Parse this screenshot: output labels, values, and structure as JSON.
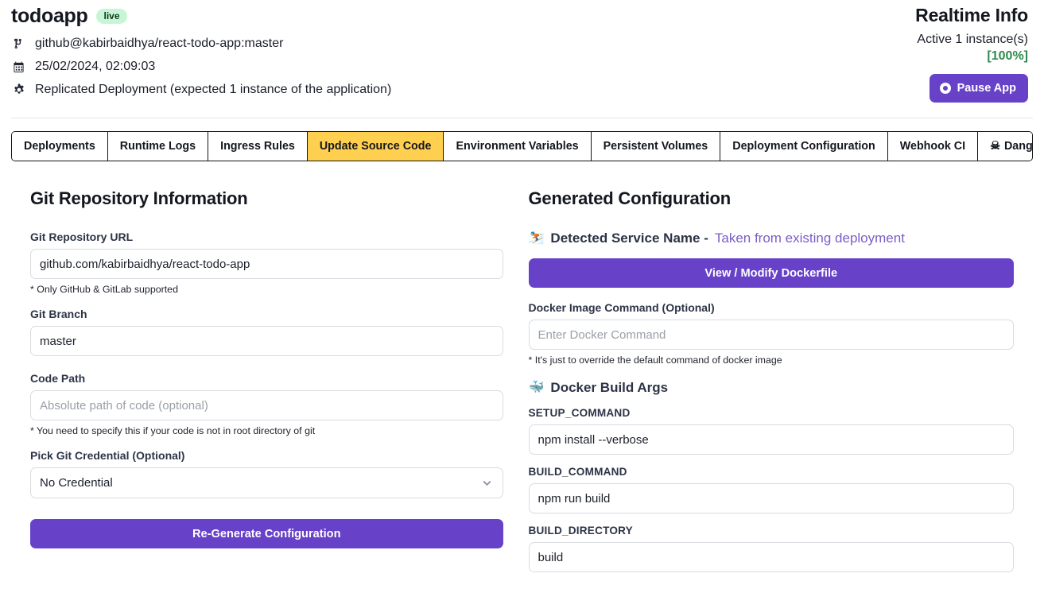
{
  "header": {
    "app_title": "todoapp",
    "status_badge": "live",
    "repo": "github@kabirbaidhya/react-todo-app:master",
    "timestamp": "25/02/2024, 02:09:03",
    "deployment_info": "Replicated Deployment (expected 1 instance of the application)",
    "icons": {
      "repo": "git-branch-icon",
      "date": "calendar-icon",
      "deployment": "gear-icon"
    }
  },
  "realtime": {
    "title": "Realtime Info",
    "active_text": "Active 1 instance(s)",
    "percent": "[100%]",
    "percent_color": "#2f8a4e",
    "pause_label": "Pause App",
    "pause_bg": "#6741c8"
  },
  "tabs": {
    "active_bg": "#ffcf4f",
    "items": [
      {
        "label": "Deployments",
        "active": false
      },
      {
        "label": "Runtime Logs",
        "active": false
      },
      {
        "label": "Ingress Rules",
        "active": false
      },
      {
        "label": "Update Source Code",
        "active": true
      },
      {
        "label": "Environment Variables",
        "active": false
      },
      {
        "label": "Persistent Volumes",
        "active": false
      },
      {
        "label": "Deployment Configuration",
        "active": false
      },
      {
        "label": "Webhook CI",
        "active": false
      },
      {
        "label": "Danger Zone",
        "active": false,
        "icon": "skull-crossbones-icon",
        "glyph": "☠"
      }
    ]
  },
  "git_section": {
    "title": "Git Repository Information",
    "repo_url": {
      "label": "Git Repository URL",
      "value": "github.com/kabirbaidhya/react-todo-app",
      "placeholder": "",
      "helper": "* Only GitHub & GitLab supported"
    },
    "branch": {
      "label": "Git Branch",
      "value": "master",
      "placeholder": ""
    },
    "code_path": {
      "label": "Code Path",
      "value": "",
      "placeholder": "Absolute path of code (optional)",
      "helper": "* You need to specify this if your code is not in root directory of git"
    },
    "credential": {
      "label": "Pick Git Credential (Optional)",
      "selected": "No Credential",
      "options": [
        "No Credential"
      ],
      "chevron_icon": "chevron-down-icon"
    },
    "submit_label": "Re-Generate Configuration",
    "submit_bg": "#6741c8"
  },
  "generated_section": {
    "title": "Generated Configuration",
    "detected": {
      "emoji": "⛷️",
      "icon": "skier-emoji-icon",
      "label": "Detected Service Name -",
      "note": "Taken from existing deployment",
      "note_color": "#7c5dc7"
    },
    "dockerfile_button": "View / Modify Dockerfile",
    "docker_command": {
      "label": "Docker Image Command (Optional)",
      "value": "",
      "placeholder": "Enter Docker Command",
      "helper": "* It's just to override the default command of docker image"
    },
    "build_args": {
      "emoji": "🐳",
      "icon": "whale-emoji-icon",
      "heading": "Docker Build Args",
      "fields": [
        {
          "label": "SETUP_COMMAND",
          "value": "npm install --verbose"
        },
        {
          "label": "BUILD_COMMAND",
          "value": "npm run build"
        },
        {
          "label": "BUILD_DIRECTORY",
          "value": "build"
        }
      ]
    }
  }
}
